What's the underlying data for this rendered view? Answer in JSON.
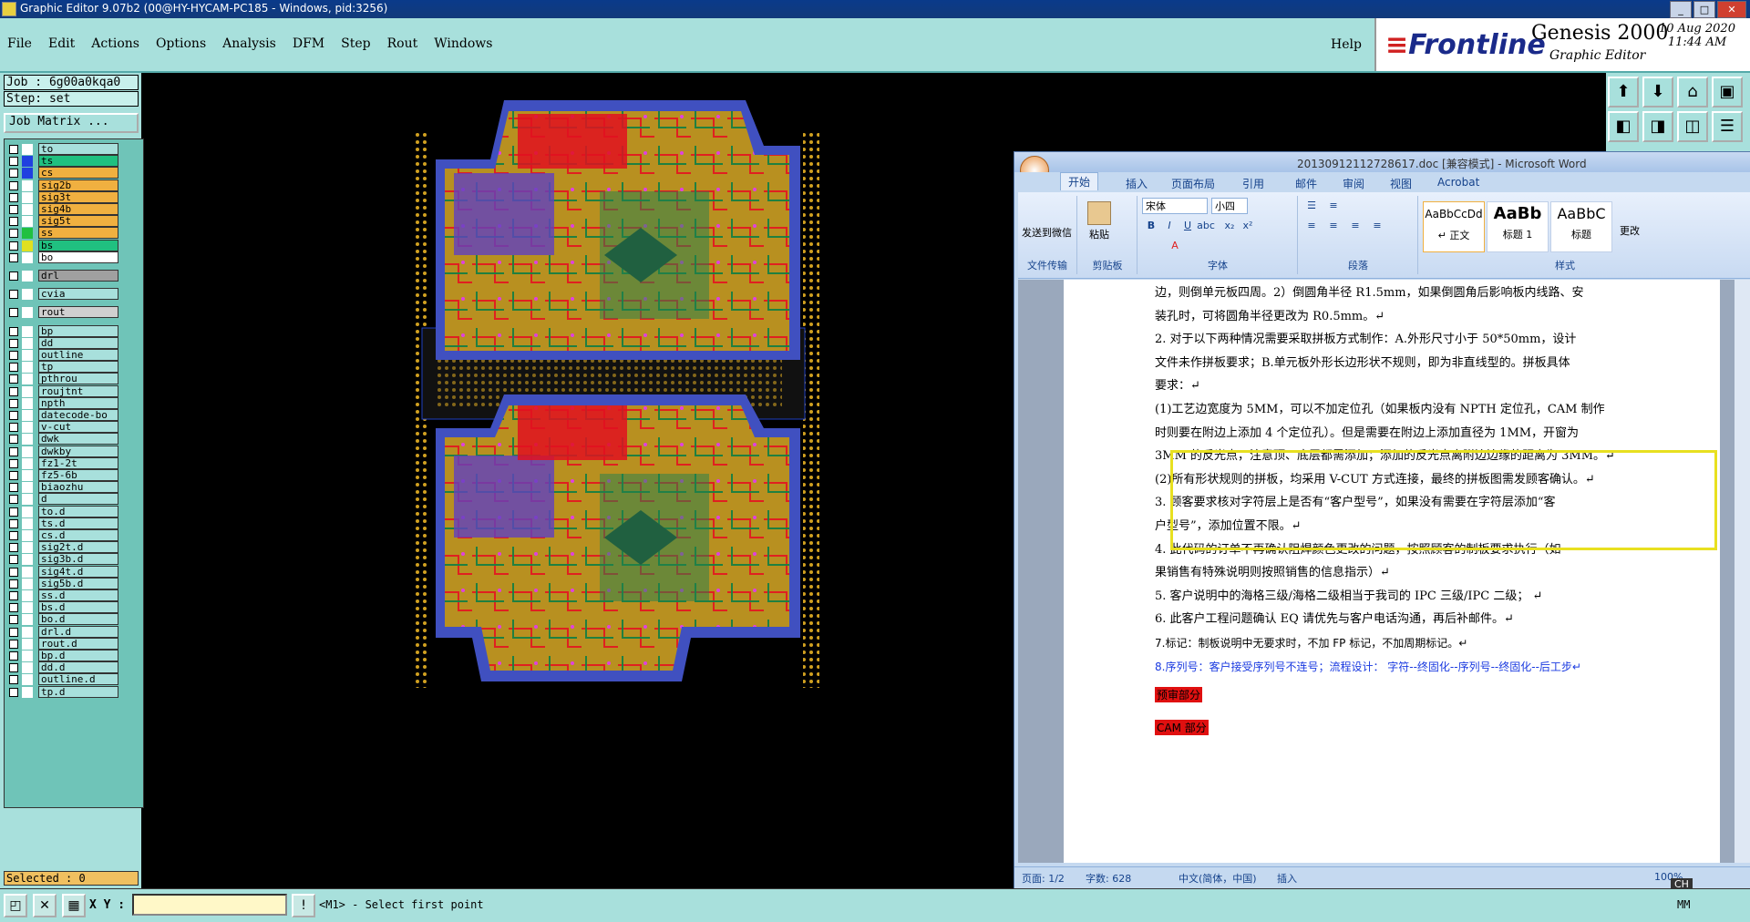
{
  "window": {
    "title": "Graphic Editor 9.07b2 (00@HY-HYCAM-PC185 - Windows, pid:3256)"
  },
  "menu": [
    "File",
    "Edit",
    "Actions",
    "Options",
    "Analysis",
    "DFM",
    "Step",
    "Rout",
    "Windows"
  ],
  "help_label": "Help",
  "brand": {
    "logo": "Frontline",
    "product": "Genesis 2000",
    "subtitle": "Graphic Editor",
    "date": "10 Aug 2020",
    "time": "11:44 AM"
  },
  "job": {
    "job_label": "Job : 6g00a0kqa0",
    "step_label": "Step: set",
    "matrix_button": "Job Matrix ..."
  },
  "layers": [
    {
      "name": "to",
      "color": "#ffffff"
    },
    {
      "name": "ts",
      "color": "#2040e0",
      "row": "#20c080"
    },
    {
      "name": "cs",
      "color": "#2040e0",
      "row": "#f0b040"
    },
    {
      "name": "sig2b",
      "color": "#ffffff",
      "row": "#f0b040"
    },
    {
      "name": "sig3t",
      "color": "#ffffff",
      "row": "#f0b040"
    },
    {
      "name": "sig4b",
      "color": "#ffffff",
      "row": "#f0b040"
    },
    {
      "name": "sig5t",
      "color": "#ffffff",
      "row": "#f0b040"
    },
    {
      "name": "ss",
      "color": "#20c040",
      "row": "#f0b040"
    },
    {
      "name": "bs",
      "color": "#e0e020",
      "row": "#20c080"
    },
    {
      "name": "bo",
      "color": "#ffffff",
      "row": "#ffffff"
    },
    {
      "name": "drl",
      "color": "#ffffff",
      "row": "#a0a0a0"
    },
    {
      "name": "cvia",
      "color": "#ffffff"
    },
    {
      "name": "rout",
      "color": "#ffffff",
      "row": "#d0d0d0"
    },
    {
      "name": "bp",
      "color": "#ffffff"
    },
    {
      "name": "dd",
      "color": "#ffffff"
    },
    {
      "name": "outline",
      "color": "#ffffff"
    },
    {
      "name": "tp",
      "color": "#ffffff"
    },
    {
      "name": "pthrou",
      "color": "#ffffff"
    },
    {
      "name": "roujtnt",
      "color": "#ffffff"
    },
    {
      "name": "npth",
      "color": "#ffffff"
    },
    {
      "name": "datecode-bo",
      "color": "#ffffff"
    },
    {
      "name": "v-cut",
      "color": "#ffffff"
    },
    {
      "name": "dwk",
      "color": "#ffffff"
    },
    {
      "name": "dwkby",
      "color": "#ffffff"
    },
    {
      "name": "fz1-2t",
      "color": "#ffffff"
    },
    {
      "name": "fz5-6b",
      "color": "#ffffff"
    },
    {
      "name": "biaozhu",
      "color": "#ffffff"
    },
    {
      "name": "d",
      "color": "#ffffff"
    },
    {
      "name": "to.d",
      "color": "#ffffff"
    },
    {
      "name": "ts.d",
      "color": "#ffffff"
    },
    {
      "name": "cs.d",
      "color": "#ffffff"
    },
    {
      "name": "sig2t.d",
      "color": "#ffffff"
    },
    {
      "name": "sig3b.d",
      "color": "#ffffff"
    },
    {
      "name": "sig4t.d",
      "color": "#ffffff"
    },
    {
      "name": "sig5b.d",
      "color": "#ffffff"
    },
    {
      "name": "ss.d",
      "color": "#ffffff"
    },
    {
      "name": "bs.d",
      "color": "#ffffff"
    },
    {
      "name": "bo.d",
      "color": "#ffffff"
    },
    {
      "name": "drl.d",
      "color": "#ffffff"
    },
    {
      "name": "rout.d",
      "color": "#ffffff"
    },
    {
      "name": "bp.d",
      "color": "#ffffff"
    },
    {
      "name": "dd.d",
      "color": "#ffffff"
    },
    {
      "name": "outline.d",
      "color": "#ffffff"
    },
    {
      "name": "tp.d",
      "color": "#ffffff"
    }
  ],
  "selected_label": "Selected : 0",
  "status": {
    "xy_label": "X Y :",
    "message": "<M1> - Select first point",
    "units": "MM"
  },
  "word": {
    "title": "20130912112728617.doc [兼容模式] - Microsoft Word",
    "tabs": [
      "开始",
      "插入",
      "页面布局",
      "引用",
      "邮件",
      "审阅",
      "视图",
      "Acrobat"
    ],
    "groups": [
      "文件传输",
      "剪贴板",
      "字体",
      "段落",
      "样式"
    ],
    "send_label": "发送到微信",
    "paste_label": "粘贴",
    "font_name": "宋体",
    "font_size": "小四",
    "styles": [
      {
        "sample": "AaBbCcDd",
        "name": "↵ 正文"
      },
      {
        "sample": "AaBb",
        "name": "标题 1"
      },
      {
        "sample": "AaBbC",
        "name": "标题"
      }
    ],
    "change_style": "更改",
    "paragraphs": [
      "边，则倒单元板四周。2）倒圆角半径 R1.5mm，如果倒圆角后影响板内线路、安",
      "装孔时，可将圆角半径更改为 R0.5mm。↵",
      "2. 对于以下两种情况需要采取拼板方式制作：A.外形尺寸小于 50*50mm，设计",
      "文件未作拼板要求；B.单元板外形长边形状不规则，即为非直线型的。拼板具体",
      "要求：↵",
      "(1)工艺边宽度为 5MM，可以不加定位孔（如果板内没有 NPTH 定位孔，CAM 制作",
      "时则要在附边上添加 4 个定位孔）。但是需要在附边上添加直径为 1MM，开窗为",
      "3MM 的反光点，注意顶、底层都需添加；添加的反光点离附边边缘的距离为 3MM。↵",
      "(2)所有形状规则的拼板，均采用 V-CUT 方式连接，最终的拼板图需发顾客确认。↵",
      "3. 顾客要求核对字符层上是否有“客户型号”，如果没有需要在字符层添加“客",
      "户型号”，添加位置不限。↵",
      "4. 此代码的订单不再确认阻焊颜色更改的问题，按照顾客的制板要求执行（如",
      "果销售有特殊说明则按照销售的信息指示）↵",
      "5. 客户说明中的海格三级/海格二级相当于我司的 IPC 三级/IPC 二级； ↵",
      "6. 此客户工程问题确认 EQ 请优先与客户电话沟通，再后补邮件。↵",
      "7.标记：制板说明中无要求时，不加 FP 标记，不加周期标记。↵",
      "8.序列号：客户接受序列号不连号；流程设计： 字符--终固化--序列号--终固化--后工步↵"
    ],
    "red_labels": [
      "预审部分",
      "CAM 部分"
    ],
    "statusbar": {
      "page": "页面: 1/2",
      "words": "字数: 628",
      "lang": "中文(简体，中国)",
      "mode": "插入",
      "zoom": "100%",
      "ime": "CH"
    }
  }
}
